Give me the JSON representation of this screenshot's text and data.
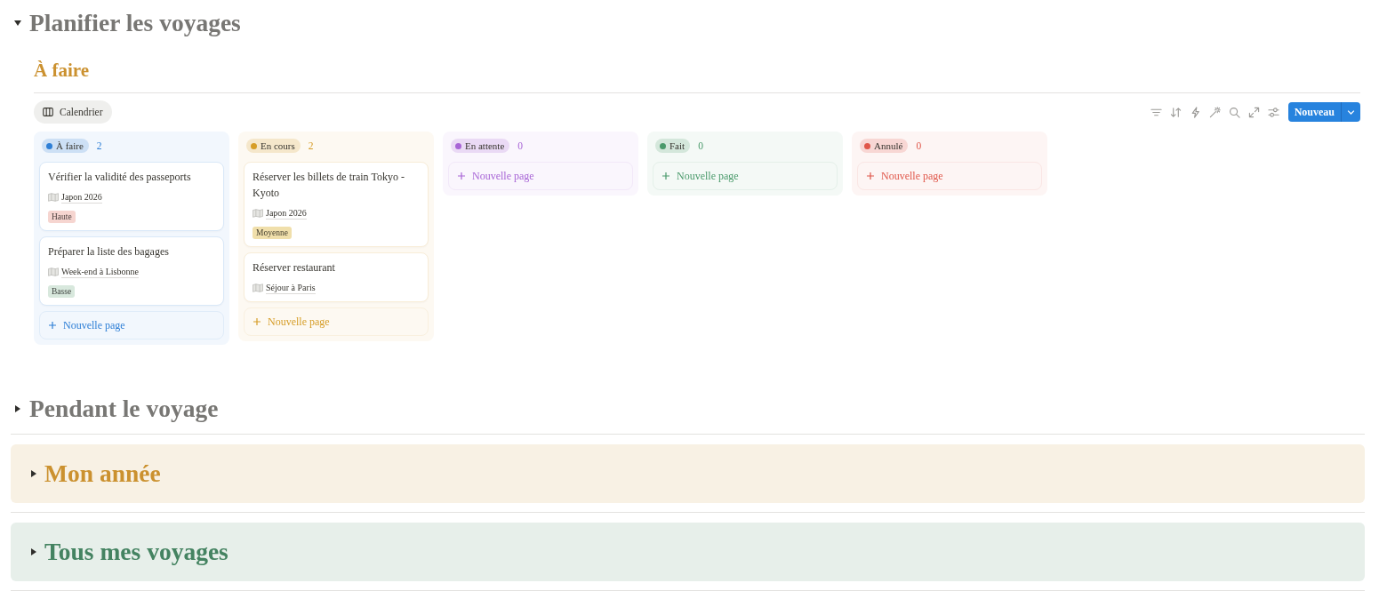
{
  "blocks": [
    {
      "kind": "toggle",
      "title": "Planifier les voyages",
      "color": "#787774",
      "expanded": true,
      "database": {
        "title": "À faire",
        "views": [
          {
            "label": "Calendrier",
            "selected": true
          }
        ],
        "new_button": {
          "label": "Nouveau"
        },
        "columns": [
          {
            "label": "À faire",
            "count": "2",
            "color": "#2e7fd6",
            "cards": [
              {
                "title": "Vérifier la validité des passeports",
                "project": "Japon 2026",
                "priority": {
                  "label": "Haute",
                  "color": "#f6d5d0"
                }
              },
              {
                "title": "Préparer la liste des bagages",
                "project": "Week-end à Lisbonne",
                "priority": {
                  "label": "Basse",
                  "color": "#d8e8dd"
                }
              }
            ],
            "add_label": "Nouvelle page"
          },
          {
            "label": "En cours",
            "count": "2",
            "color": "#d69d27",
            "cards": [
              {
                "title": "Réserver les billets de train Tokyo - Kyoto",
                "project": "Japon 2026",
                "priority": {
                  "label": "Moyenne",
                  "color": "#f0dfab"
                }
              },
              {
                "title": "Réserver restaurant",
                "project": "Séjour à Paris"
              }
            ],
            "add_label": "Nouvelle page"
          },
          {
            "label": "En attente",
            "count": "0",
            "color": "#a865d6",
            "add_label": "Nouvelle page"
          },
          {
            "label": "Fait",
            "count": "0",
            "color": "#4a9a6b",
            "add_label": "Nouvelle page"
          },
          {
            "label": "Annulé",
            "count": "0",
            "color": "#e0574a",
            "add_label": "Nouvelle page"
          }
        ]
      }
    },
    {
      "kind": "toggle",
      "title": "Pendant le voyage",
      "color": "#787774",
      "expanded": false
    },
    {
      "kind": "divider"
    },
    {
      "kind": "callout",
      "title": "Mon année",
      "color": "#cb912f",
      "expanded": false
    },
    {
      "kind": "divider"
    },
    {
      "kind": "callout",
      "title": "Tous mes voyages",
      "color": "#448361",
      "expanded": false
    },
    {
      "kind": "divider"
    }
  ]
}
